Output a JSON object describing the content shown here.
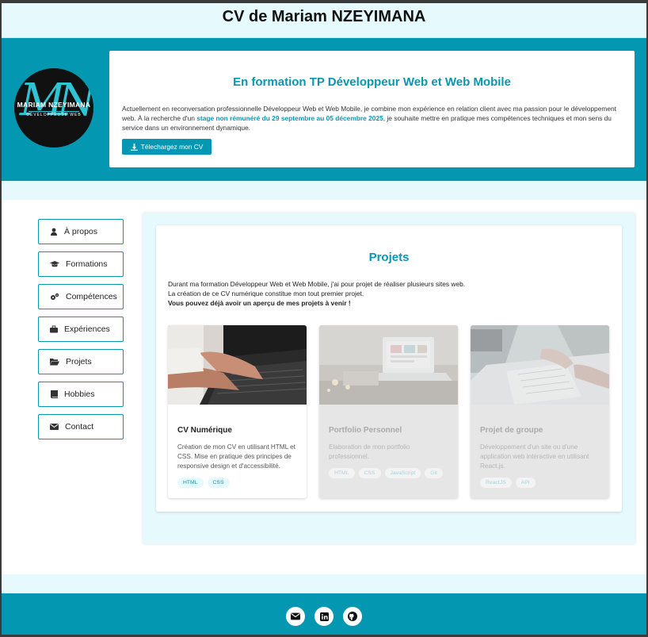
{
  "page": {
    "title": "CV de Mariam NZEYIMANA"
  },
  "hero": {
    "avatar": {
      "monogram": "MN",
      "name": "MARIAM NZEYIMANA",
      "role": "DÉVELOPPEUSE WEB"
    },
    "heading": "En formation TP Développeur Web et Web Mobile",
    "text_before": "Actuellement en reconversation professionnelle Développeur Web et Web Mobile, je combine mon expérience en relation client avec ma passion pour le développement web. À la recherche d'un ",
    "text_highlight": "stage non rémunéré du 29 septembre au 05 décembre 2025",
    "text_after": ", je souhaite mettre en pratique mes compétences techniques et mon sens du service dans un environnement dynamique.",
    "download_label": "Télechargez mon CV",
    "download_icon": "download-icon"
  },
  "nav": {
    "items": [
      {
        "label": "À propos",
        "icon": "user-icon"
      },
      {
        "label": "Formations",
        "icon": "graduation-cap-icon"
      },
      {
        "label": "Compétences",
        "icon": "cogs-icon"
      },
      {
        "label": "Expériences",
        "icon": "briefcase-icon"
      },
      {
        "label": "Projets",
        "icon": "folder-open-icon"
      },
      {
        "label": "Hobbies",
        "icon": "book-icon"
      },
      {
        "label": "Contact",
        "icon": "envelope-icon"
      }
    ]
  },
  "projects": {
    "title": "Projets",
    "intro_line1": "Durant ma formation Développeur Web et Web Mobile, j'ai pour projet de réaliser plusieurs sites web.",
    "intro_line2": "La création de ce CV numérique constitue mon tout premier projet.",
    "intro_line3": "Vous pouvez déjà avoir un aperçu de mes projets à venir !",
    "cards": [
      {
        "title": "CV Numérique",
        "description": "Création de mon CV en utilisant HTML et CSS. Mise en pratique des principes de responsive design et d'accessibilité.",
        "tags": [
          "HTML",
          "CSS"
        ]
      },
      {
        "title": "Portfolio Personnel",
        "description": "Elaboration de mon portfolio professionnel.",
        "tags": [
          "HTML",
          "CSS",
          "JavaScript",
          "Git"
        ]
      },
      {
        "title": "Projet de groupe",
        "description": "Développement d'un site ou d'une application web interactive en utilisant React.js.",
        "tags": [
          "ReactJS",
          "API"
        ]
      }
    ]
  },
  "footer": {
    "social": [
      "envelope-icon",
      "linkedin-icon",
      "github-icon"
    ]
  },
  "colors": {
    "accent": "#0497b2",
    "light": "#e6fafd"
  }
}
